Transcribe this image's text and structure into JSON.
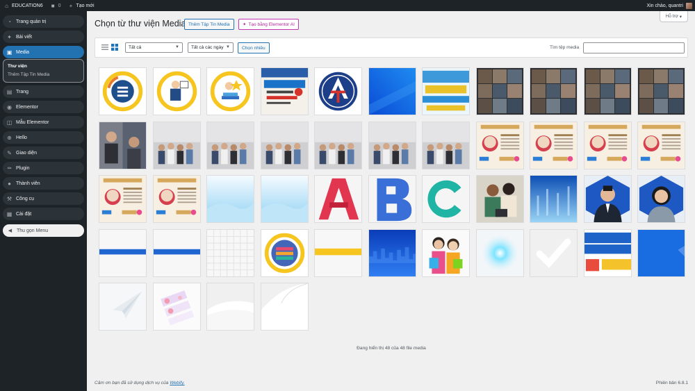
{
  "adminbar": {
    "site_name": "EDUCATION6",
    "comments_count": "0",
    "new_label": "Tạo mới",
    "greeting": "Xin chào, quantri"
  },
  "sidebar": {
    "items": [
      {
        "label": "Trang quản trị",
        "icon": "dashboard-icon"
      },
      {
        "label": "Bài viết",
        "icon": "pin-icon"
      },
      {
        "label": "Media",
        "icon": "media-icon",
        "current": true
      },
      {
        "label": "Trang",
        "icon": "page-icon"
      },
      {
        "label": "Elementor",
        "icon": "elementor-icon"
      },
      {
        "label": "Mẫu Elementor",
        "icon": "folder-icon"
      },
      {
        "label": "Hello",
        "icon": "plus-circle-icon"
      },
      {
        "label": "Giao diện",
        "icon": "brush-icon"
      },
      {
        "label": "Plugin",
        "icon": "plugin-icon"
      },
      {
        "label": "Thành viên",
        "icon": "user-icon"
      },
      {
        "label": "Công cụ",
        "icon": "wrench-icon"
      },
      {
        "label": "Cài đặt",
        "icon": "settings-icon"
      }
    ],
    "submenu": [
      "Thư viện",
      "Thêm Tập Tin Media"
    ],
    "collapse_label": "Thu gọn Menu"
  },
  "help_label": "Hỗ trợ",
  "page": {
    "title": "Chọn từ thư viện Media",
    "add_button": "Thêm Tập Tin Media",
    "ai_button": "Tạo bằng Elementor AI"
  },
  "toolbar": {
    "type_filter": "Tất cả",
    "date_filter": "Tất cả các ngày",
    "bulk_select": "Chọn nhiều",
    "search_label": "Tìm tệp media",
    "search_value": ""
  },
  "media_items": [
    {
      "kind": "icon-cycle"
    },
    {
      "kind": "icon-teacher"
    },
    {
      "kind": "icon-student"
    },
    {
      "kind": "flyer-review"
    },
    {
      "kind": "logo-ta"
    },
    {
      "kind": "blue-gradient"
    },
    {
      "kind": "banner-tuvan"
    },
    {
      "kind": "video-grid"
    },
    {
      "kind": "video-grid"
    },
    {
      "kind": "video-grid"
    },
    {
      "kind": "video-grid"
    },
    {
      "kind": "photo"
    },
    {
      "kind": "photo-class"
    },
    {
      "kind": "photo-class"
    },
    {
      "kind": "photo-class"
    },
    {
      "kind": "photo-class"
    },
    {
      "kind": "photo-class"
    },
    {
      "kind": "photo-class"
    },
    {
      "kind": "honor"
    },
    {
      "kind": "honor"
    },
    {
      "kind": "honor"
    },
    {
      "kind": "honor"
    },
    {
      "kind": "honor"
    },
    {
      "kind": "honor"
    },
    {
      "kind": "sky"
    },
    {
      "kind": "sky"
    },
    {
      "kind": "letter-a"
    },
    {
      "kind": "letter-b"
    },
    {
      "kind": "letter-c"
    },
    {
      "kind": "photo-people"
    },
    {
      "kind": "blue-light"
    },
    {
      "kind": "portrait-man"
    },
    {
      "kind": "portrait-woman"
    },
    {
      "kind": "blue-stripe"
    },
    {
      "kind": "blue-stripe"
    },
    {
      "kind": "grid-light"
    },
    {
      "kind": "icon-books"
    },
    {
      "kind": "yellow-stripe"
    },
    {
      "kind": "city-blue"
    },
    {
      "kind": "students"
    },
    {
      "kind": "light-burst"
    },
    {
      "kind": "checkmark"
    },
    {
      "kind": "banner-thi"
    },
    {
      "kind": "blue-solid"
    },
    {
      "kind": "paper-plane"
    },
    {
      "kind": "pink-cards"
    },
    {
      "kind": "white-wave"
    },
    {
      "kind": "page-curl"
    }
  ],
  "status": {
    "count_text": "Đang hiển thị 48 của 48 file media"
  },
  "footer": {
    "thanks_prefix": "Cảm ơn bạn đã sử dụng dịch vụ của",
    "thanks_link": "Webify.",
    "version": "Phiên bản 6.8.1"
  },
  "colors": {
    "admin_dark": "#1d2327",
    "accent": "#2271b1",
    "ai_accent": "#c036b4"
  }
}
